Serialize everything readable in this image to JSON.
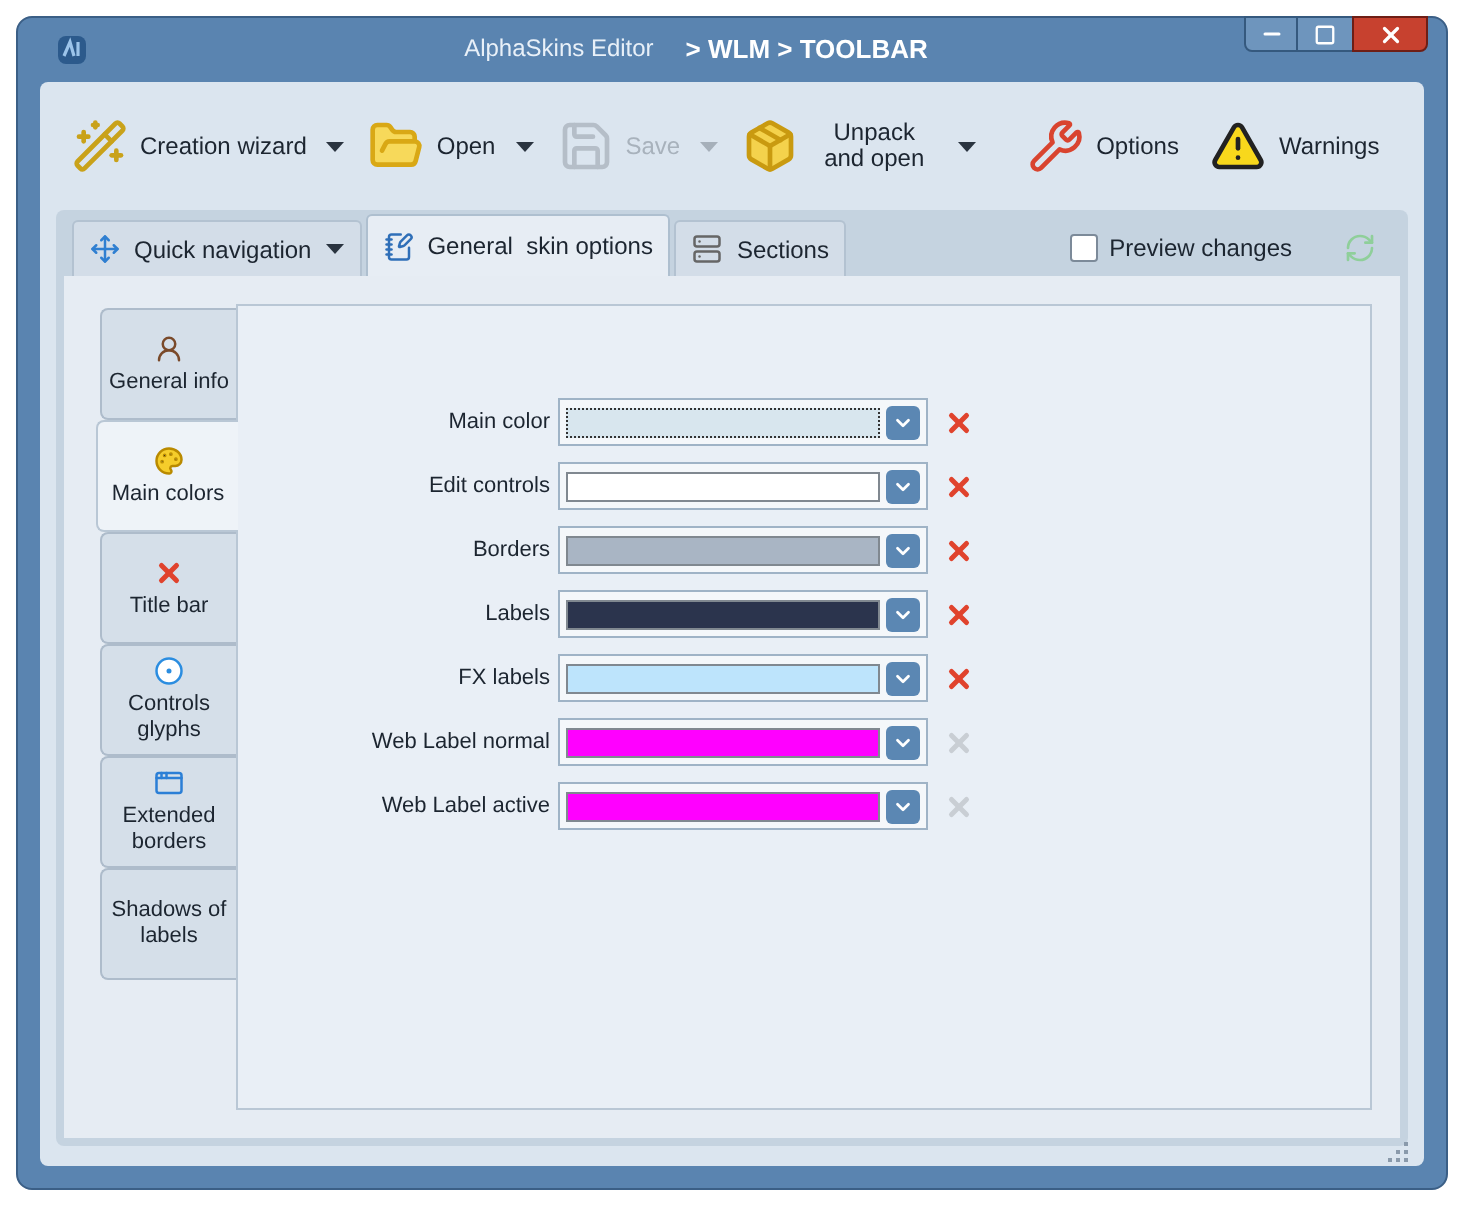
{
  "window": {
    "title": "AlphaSkins Editor",
    "path": "> WLM > TOOLBAR"
  },
  "toolbar": [
    {
      "kind": "wand",
      "label": "Creation wizard",
      "dropdown": true,
      "disabled": false
    },
    {
      "kind": "folder",
      "label": "Open",
      "dropdown": true,
      "disabled": false
    },
    {
      "kind": "save",
      "label": "Save",
      "dropdown": true,
      "disabled": true
    },
    {
      "kind": "box",
      "label": "Unpack and open",
      "dropdown": true,
      "disabled": false
    },
    {
      "kind": "wrench",
      "label": "Options",
      "dropdown": false,
      "disabled": false
    },
    {
      "kind": "warning",
      "label": "Warnings",
      "dropdown": false,
      "disabled": false
    }
  ],
  "tabs": [
    {
      "kind": "nav",
      "label": "Quick navigation",
      "selected": false,
      "dropdown": true
    },
    {
      "kind": "pencil",
      "label": "General  skin options",
      "selected": true,
      "dropdown": false
    },
    {
      "kind": "stack",
      "label": "Sections",
      "selected": false,
      "dropdown": false
    }
  ],
  "preview": {
    "label": "Preview changes",
    "checked": false
  },
  "side_tabs": [
    {
      "kind": "person",
      "label": "General info",
      "selected": false
    },
    {
      "kind": "palette",
      "label": "Main colors",
      "selected": true
    },
    {
      "kind": "cross",
      "label": "Title bar",
      "selected": false
    },
    {
      "kind": "radio",
      "label": "Controls glyphs",
      "selected": false
    },
    {
      "kind": "window",
      "label": "Extended borders",
      "selected": false
    },
    {
      "kind": "none",
      "label": "Shadows of labels",
      "selected": false
    }
  ],
  "colors": [
    {
      "label": "Main color",
      "color": "#d8e6ee",
      "focused": true,
      "resettable": true
    },
    {
      "label": "Edit controls",
      "color": "#ffffff",
      "focused": false,
      "resettable": true
    },
    {
      "label": "Borders",
      "color": "#a9b5c4",
      "focused": false,
      "resettable": true
    },
    {
      "label": "Labels",
      "color": "#2b344d",
      "focused": false,
      "resettable": true
    },
    {
      "label": "FX labels",
      "color": "#bde4fc",
      "focused": false,
      "resettable": true
    },
    {
      "label": "Web Label normal",
      "color": "#ff00ff",
      "focused": false,
      "resettable": false
    },
    {
      "label": "Web Label active",
      "color": "#ff00ff",
      "focused": false,
      "resettable": false
    }
  ]
}
